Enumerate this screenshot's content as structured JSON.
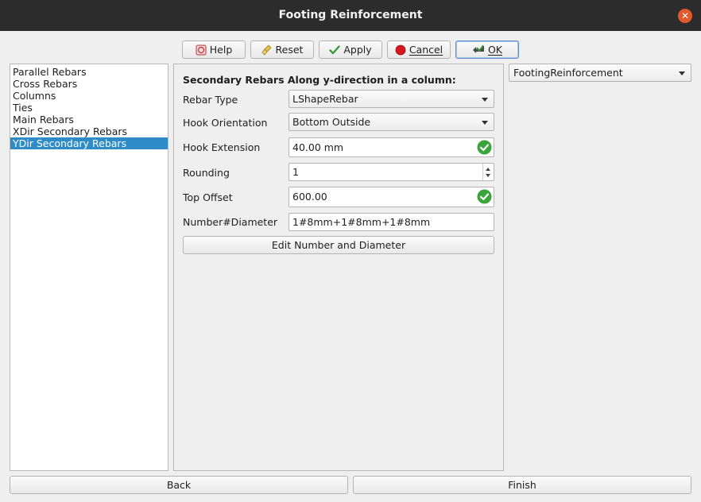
{
  "window": {
    "title": "Footing Reinforcement",
    "close_icon": "close-icon"
  },
  "toolbar": {
    "help_label": "Help",
    "reset_label": "Reset",
    "apply_label": "Apply",
    "cancel_label": "Cancel",
    "ok_label": "OK"
  },
  "sidebar": {
    "items": [
      {
        "label": "Parallel Rebars",
        "selected": false
      },
      {
        "label": "Cross Rebars",
        "selected": false
      },
      {
        "label": "Columns",
        "selected": false
      },
      {
        "label": "Ties",
        "selected": false
      },
      {
        "label": "Main Rebars",
        "selected": false
      },
      {
        "label": "XDir Secondary Rebars",
        "selected": false
      },
      {
        "label": "YDir Secondary Rebars",
        "selected": true
      }
    ]
  },
  "form": {
    "heading": "Secondary Rebars Along y-direction in a column:",
    "rebar_type": {
      "label": "Rebar Type",
      "value": "LShapeRebar"
    },
    "hook_orientation": {
      "label": "Hook Orientation",
      "value": "Bottom Outside"
    },
    "hook_extension": {
      "label": "Hook Extension",
      "value": "40.00 mm"
    },
    "rounding": {
      "label": "Rounding",
      "value": "1"
    },
    "top_offset": {
      "label": "Top Offset",
      "value": "600.00"
    },
    "number_diameter": {
      "label": "Number#Diameter",
      "value": "1#8mm+1#8mm+1#8mm"
    },
    "edit_button_label": "Edit Number and Diameter"
  },
  "object_selector": {
    "value": "FootingReinforcement"
  },
  "footer": {
    "back_label": "Back",
    "finish_label": "Finish"
  },
  "colors": {
    "titlebar": "#2c2c2c",
    "close": "#e2572b",
    "selection": "#308cc6",
    "valid_check": "#3aa53a"
  }
}
